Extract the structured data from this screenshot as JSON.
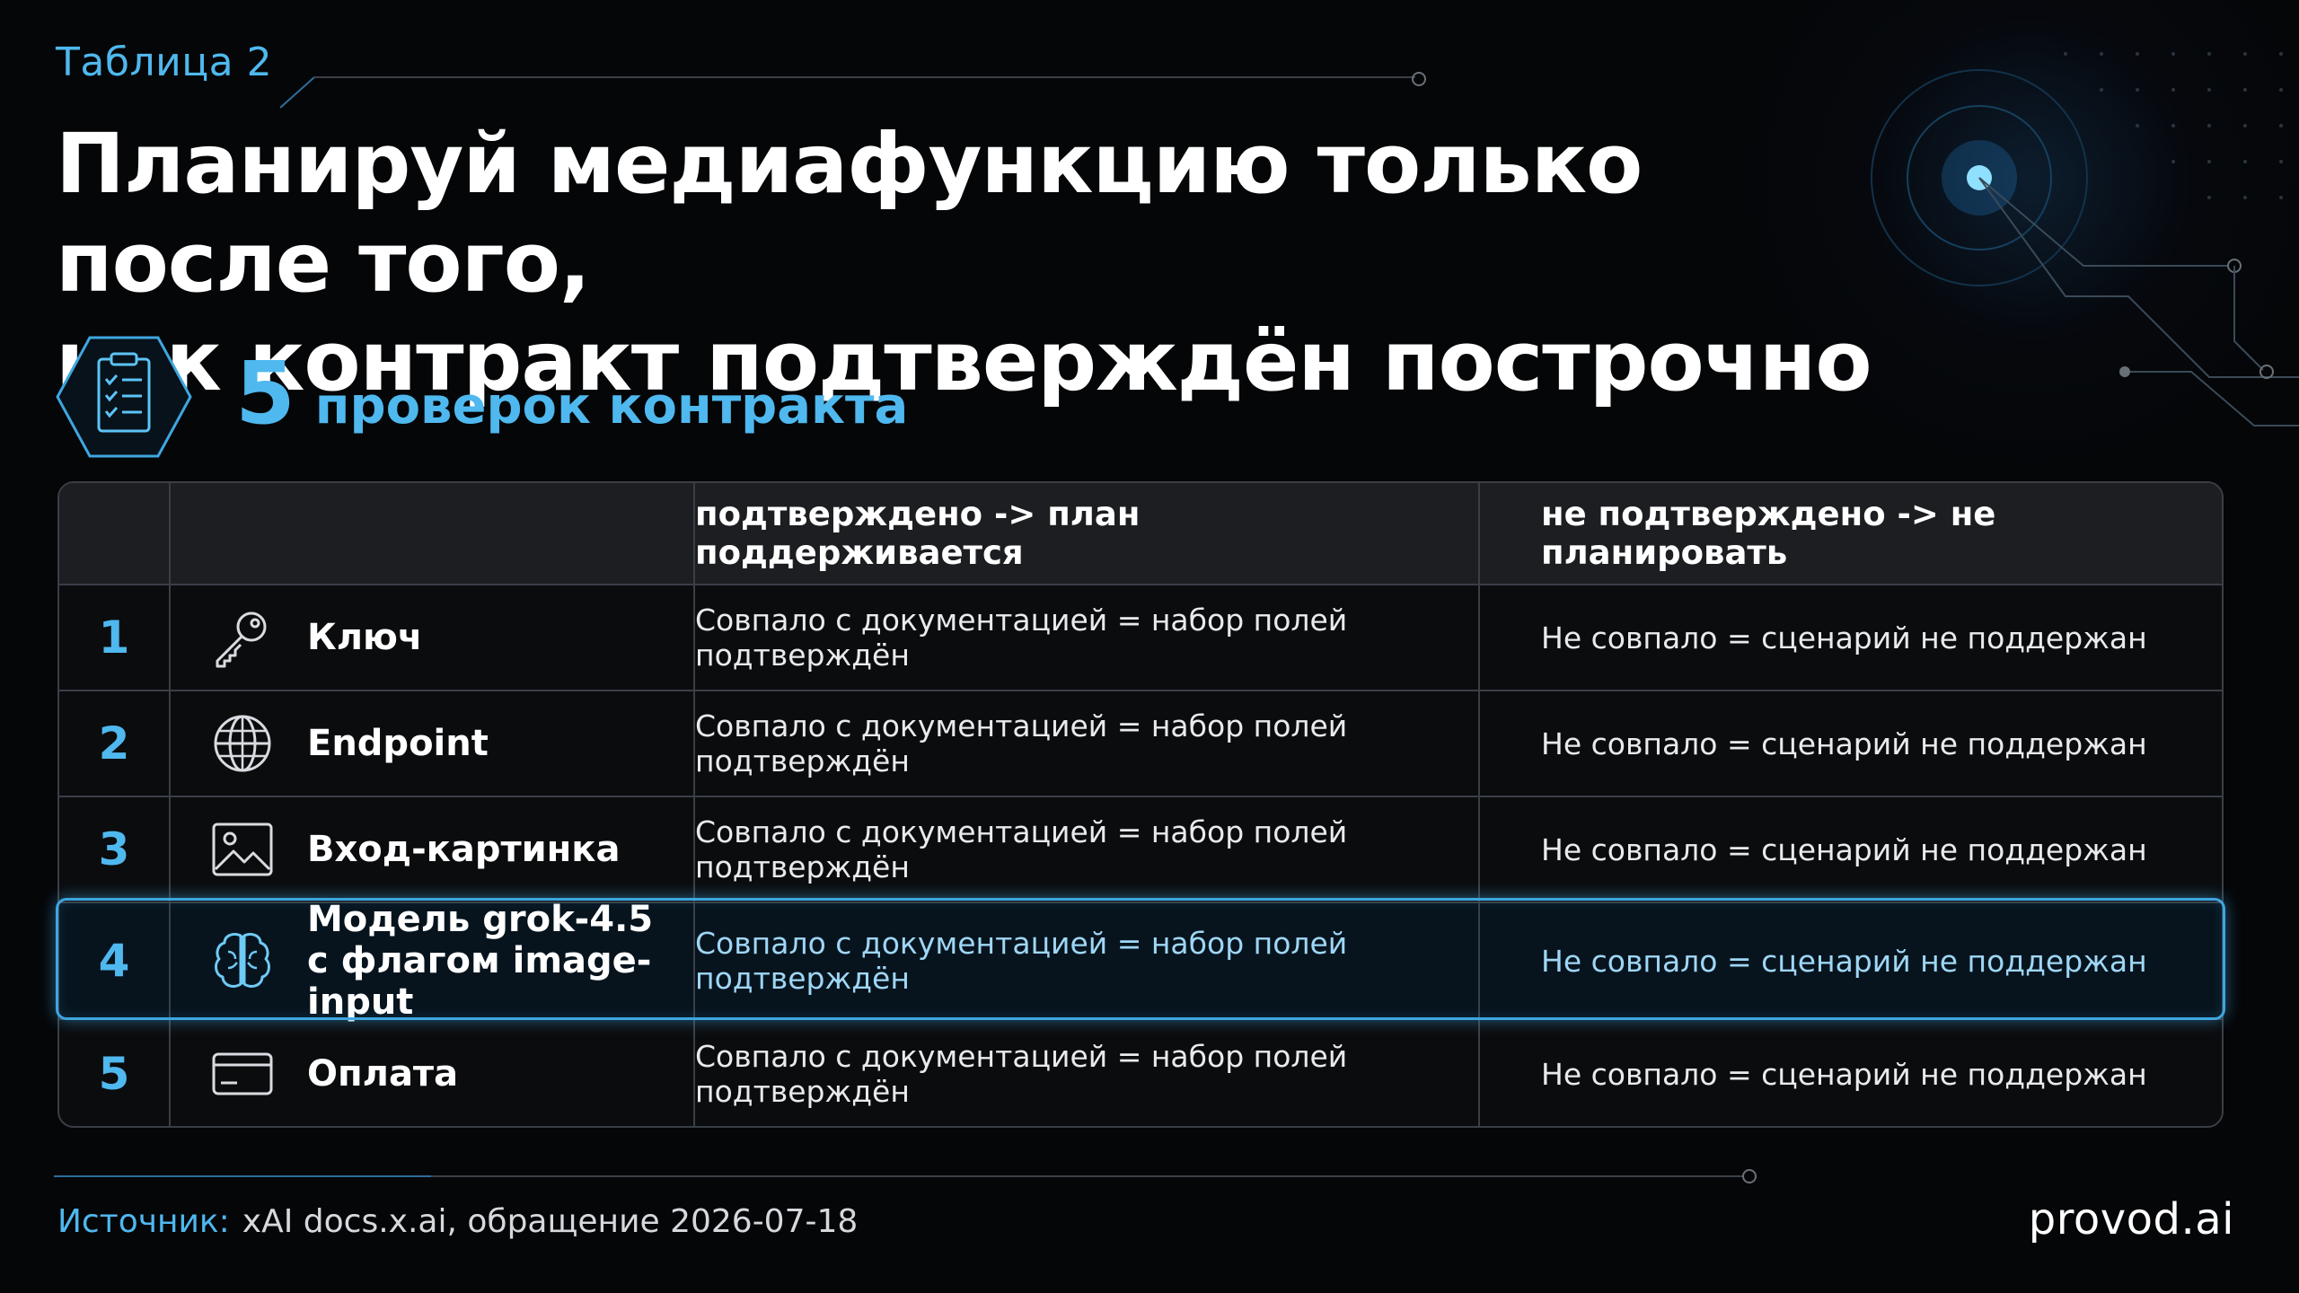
{
  "header": {
    "table_label": "Таблица 2",
    "title_line1": "Планируй медиафункцию только после того,",
    "title_line2": "как контракт подтверждён построчно"
  },
  "summary": {
    "count": "5",
    "label": "проверок контракта"
  },
  "table": {
    "columns": [
      "",
      "",
      "подтверждено -> план поддерживается",
      "не подтверждено -> не планировать"
    ],
    "rows": [
      {
        "num": "1",
        "icon": "key-icon",
        "label": "Ключ",
        "sub": "",
        "yes": "Совпало с документацией = набор полей подтверждён",
        "no": "Не совпало = сценарий не поддержан"
      },
      {
        "num": "2",
        "icon": "globe-icon",
        "label": "Endpoint",
        "sub": "",
        "yes": "Совпало с документацией = набор полей подтверждён",
        "no": "Не совпало = сценарий не поддержан"
      },
      {
        "num": "3",
        "icon": "image-icon",
        "label": "Вход-картинка",
        "sub": "",
        "yes": "Совпало с документацией = набор полей подтверждён",
        "no": "Не совпало = сценарий не поддержан"
      },
      {
        "num": "4",
        "icon": "brain-icon",
        "label": "Модель grok-4.5",
        "sub": "с флагом image-input",
        "yes": "Совпало с документацией = набор полей подтверждён",
        "no": "Не совпало = сценарий не поддержан",
        "highlighted": true
      },
      {
        "num": "5",
        "icon": "credit-card-icon",
        "label": "Оплата",
        "sub": "",
        "yes": "Совпало с документацией = набор полей подтверждён",
        "no": "Не совпало = сценарий не поддержан"
      }
    ]
  },
  "footer": {
    "source_label": "Источник:",
    "source_text": "xAI docs.x.ai, обращение 2026-07-18",
    "brand": "provod.ai"
  },
  "colors": {
    "accent": "#4fb8ee",
    "background": "#050608",
    "highlight_border": "#3ea6e0"
  }
}
